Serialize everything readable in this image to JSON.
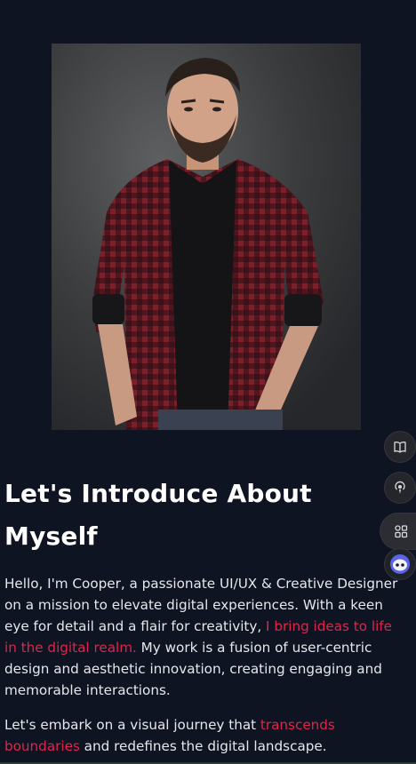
{
  "about": {
    "heading": "Let's Introduce About Myself",
    "para1": [
      {
        "text": "Hello, I'm Cooper, a passionate UI/UX & Creative Designer on a mission to elevate digital experiences. With a keen eye for detail and a flair for creativity, ",
        "accent": false
      },
      {
        "text": "I bring ideas to life in the digital realm.",
        "accent": true
      },
      {
        "text": " My work is a fusion of user-centric design and aesthetic innovation, creating engaging and memorable interactions.",
        "accent": false
      }
    ],
    "para2": [
      {
        "text": "Let's embark on a visual journey that ",
        "accent": false
      },
      {
        "text": "transcends boundaries",
        "accent": true
      },
      {
        "text": " and redefines the digital landscape.",
        "accent": false
      }
    ]
  },
  "side_tools": [
    {
      "icon": "book-icon"
    },
    {
      "icon": "broadcast-icon"
    },
    {
      "icon": "grid-icon"
    },
    {
      "icon": "assistant-icon"
    }
  ],
  "colors": {
    "background": "#0f1422",
    "accent": "#e0244b",
    "text": "#e6e7ec",
    "heading": "#ffffff"
  }
}
